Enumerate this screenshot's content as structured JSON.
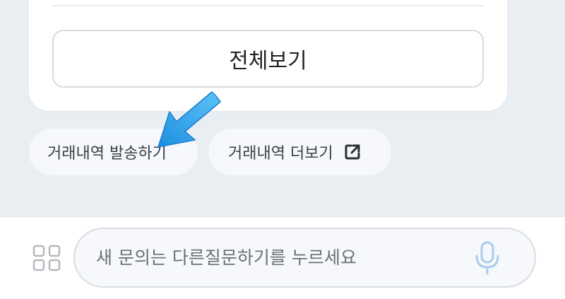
{
  "card": {
    "view_all_label": "전체보기"
  },
  "quick_replies": {
    "send_history_label": "거래내역 발송하기",
    "more_history_label": "거래내역 더보기"
  },
  "icons": {
    "external_link": "external-link-icon",
    "grid_menu": "grid-menu-icon",
    "microphone": "microphone-icon",
    "annotation_arrow": "blue-arrow-icon"
  },
  "chat_input": {
    "placeholder": "새 문의는 다른질문하기를 누르세요"
  },
  "colors": {
    "background": "#e9eef3",
    "card": "#ffffff",
    "chip": "#f6f8fb",
    "annotation_arrow": "#35a9f0",
    "mic": "#a9cdee"
  }
}
